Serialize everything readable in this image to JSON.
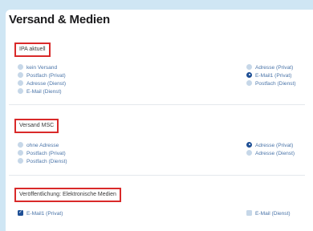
{
  "title": "Versand & Medien",
  "sections": [
    {
      "label": "IPA aktuell",
      "left": [
        {
          "label": "kein Versand",
          "checked": false
        },
        {
          "label": "Postfach (Privat)",
          "checked": false
        },
        {
          "label": "Adresse (Dienst)",
          "checked": false
        },
        {
          "label": "E-Mail (Dienst)",
          "checked": false
        }
      ],
      "right": [
        {
          "label": "Adresse (Privat)",
          "checked": false
        },
        {
          "label": "E-Mail1 (Privat)",
          "checked": true
        },
        {
          "label": "Postfach (Dienst)",
          "checked": false
        }
      ]
    },
    {
      "label": "Versand MSC",
      "left": [
        {
          "label": "ohne Adresse",
          "checked": false
        },
        {
          "label": "Postfach (Privat)",
          "checked": false
        },
        {
          "label": "Postfach (Dienst)",
          "checked": false
        }
      ],
      "right": [
        {
          "label": "Adresse (Privat)",
          "checked": true
        },
        {
          "label": "Adresse (Dienst)",
          "checked": false
        }
      ]
    },
    {
      "label": "Veröffentlichung: Elektronische Medien",
      "left": [
        {
          "label": "E-Mail1 (Privat)",
          "checked": true
        }
      ],
      "right": [
        {
          "label": "E-Mail (Dienst)",
          "checked": false
        }
      ]
    }
  ],
  "colors": {
    "accent": "#1e4f95",
    "highlight_border": "#d92a2a",
    "option_text": "#4a74a8"
  },
  "icons": {
    "checkmark": "✓"
  }
}
